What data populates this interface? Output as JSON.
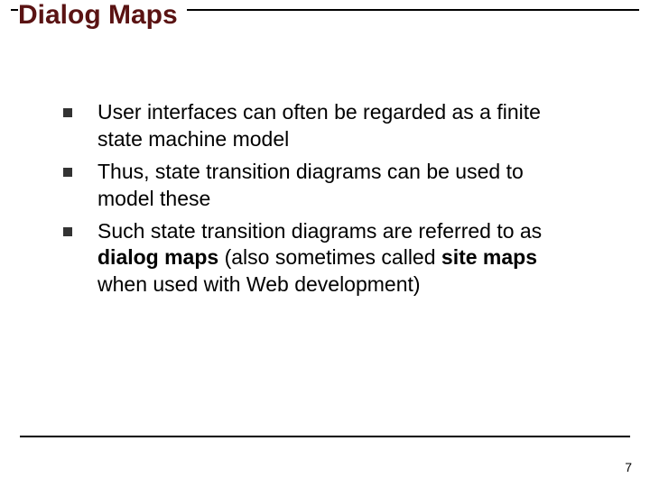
{
  "title": "Dialog Maps",
  "bullets": [
    {
      "html": "User interfaces can often be regarded as a finite state machine model"
    },
    {
      "html": "Thus, state transition diagrams can be used to model these"
    },
    {
      "html": "Such state transition diagrams are referred to as <b>dialog maps</b> (also sometimes called <b>site maps</b> when used with Web development)"
    }
  ],
  "page_number": "7"
}
